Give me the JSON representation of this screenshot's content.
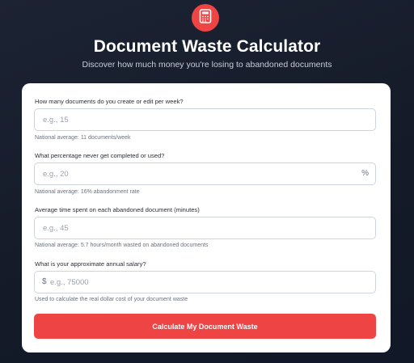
{
  "header": {
    "logo_icon": "calculator-icon",
    "title": "Document Waste Calculator",
    "subtitle": "Discover how much money you're losing to abandoned documents"
  },
  "form": {
    "fields": [
      {
        "label": "How many documents do you create or edit per week?",
        "placeholder": "e.g., 15",
        "hint": "National average: 11 documents/week"
      },
      {
        "label": "What percentage never get completed or used?",
        "placeholder": "e.g., 20",
        "suffix": "%",
        "hint": "National average: 16% abandonment rate"
      },
      {
        "label": "Average time spent on each abandoned document (minutes)",
        "placeholder": "e.g., 45",
        "hint": "National average: 5.7 hours/month wasted on abandoned documents"
      },
      {
        "label": "What is your approximate annual salary?",
        "placeholder": "e.g., 75000",
        "prefix": "$",
        "hint": "Used to calculate the real dollar cost of your document waste"
      }
    ],
    "submit_label": "Calculate My Document Waste"
  },
  "colors": {
    "accent": "#ef4444",
    "background": "#1a2130",
    "card": "#ffffff"
  }
}
